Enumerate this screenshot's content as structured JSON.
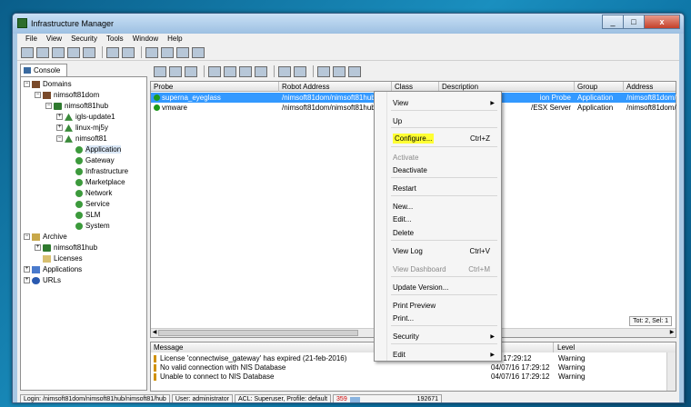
{
  "window": {
    "title": "Infrastructure Manager",
    "minimize": "_",
    "maximize": "□",
    "close": "x"
  },
  "menubar": [
    "File",
    "View",
    "Security",
    "Tools",
    "Window",
    "Help"
  ],
  "left_panel": {
    "tab_label": "Console",
    "tree": [
      {
        "label": "Domains",
        "level": 0,
        "expander": "−",
        "icon": "domain-icon"
      },
      {
        "label": "nimsoft81dom",
        "level": 1,
        "expander": "−",
        "icon": "domain-icon"
      },
      {
        "label": "nimsoft81hub",
        "level": 2,
        "expander": "−",
        "icon": "hub-icon"
      },
      {
        "label": "igls-update1",
        "level": 3,
        "expander": "+",
        "icon": "robot-icon"
      },
      {
        "label": "linux-mj5y",
        "level": 3,
        "expander": "+",
        "icon": "robot-icon"
      },
      {
        "label": "nimsoft81",
        "level": 3,
        "expander": "−",
        "icon": "robot-icon"
      },
      {
        "label": "Application",
        "level": 4,
        "expander": "",
        "icon": "group-icon",
        "selected": true
      },
      {
        "label": "Gateway",
        "level": 4,
        "expander": "",
        "icon": "group-icon"
      },
      {
        "label": "Infrastructure",
        "level": 4,
        "expander": "",
        "icon": "group-icon"
      },
      {
        "label": "Marketplace",
        "level": 4,
        "expander": "",
        "icon": "group-icon"
      },
      {
        "label": "Network",
        "level": 4,
        "expander": "",
        "icon": "group-icon"
      },
      {
        "label": "Service",
        "level": 4,
        "expander": "",
        "icon": "group-icon"
      },
      {
        "label": "SLM",
        "level": 4,
        "expander": "",
        "icon": "group-icon"
      },
      {
        "label": "System",
        "level": 4,
        "expander": "",
        "icon": "group-icon"
      },
      {
        "label": "Archive",
        "level": 0,
        "expander": "−",
        "icon": "archive-icon"
      },
      {
        "label": "nimsoft81hub",
        "level": 1,
        "expander": "+",
        "icon": "hub-icon"
      },
      {
        "label": "Licenses",
        "level": 1,
        "expander": "",
        "icon": "license-icon"
      },
      {
        "label": "Applications",
        "level": 0,
        "expander": "+",
        "icon": "applications-icon"
      },
      {
        "label": "URLs",
        "level": 0,
        "expander": "+",
        "icon": "url-icon"
      }
    ]
  },
  "probe_grid": {
    "columns": [
      "Probe",
      "Robot Address",
      "Class",
      "Description",
      "Group",
      "Address"
    ],
    "rows": [
      {
        "probe": "superna_eyeglass",
        "robot": "/nimsoft81dom/nimsoft81hub",
        "class": "",
        "description": "ion Probe",
        "group": "Application",
        "address": "/nimsoft81dom/",
        "selected": true
      },
      {
        "probe": "vmware",
        "robot": "/nimsoft81dom/nimsoft81hub",
        "class": "",
        "description": "/ESX Server",
        "group": "Application",
        "address": "/nimsoft81dom/",
        "selected": false
      }
    ],
    "total": "Tot: 2,  Sel: 1"
  },
  "messages": {
    "columns": [
      "Message",
      "",
      "Level"
    ],
    "rows": [
      {
        "message": "License 'connectwise_gateway' has expired (21-feb-2016)",
        "time": "",
        "level": "Warning"
      },
      {
        "message": "No valid connection with NIS Database",
        "time": "04/07/16 17:29:12",
        "level": "Warning"
      },
      {
        "message": "Unable to connect to NIS Database",
        "time": "04/07/16 17:29:12",
        "level": "Warning"
      }
    ],
    "first_row_time": "/16 17:29:12"
  },
  "statusbar": {
    "login": "Login: /nimsoft81dom/nimsoft81hub/nimsoft81/hub",
    "user": "User: administrator",
    "acl": "ACL: Superuser,  Profile: default",
    "mem_used": "359",
    "mem_total": "192671",
    "mem_fill": 0.19
  },
  "context_menu": {
    "items": [
      {
        "label": "View",
        "shortcut": "",
        "submenu": true,
        "disabled": false
      },
      {
        "label": "Up",
        "shortcut": "",
        "submenu": false,
        "disabled": false
      },
      {
        "label": "Configure...",
        "shortcut": "Ctrl+Z",
        "submenu": false,
        "disabled": false,
        "highlighted": true
      },
      {
        "label": "Activate",
        "shortcut": "",
        "submenu": false,
        "disabled": true
      },
      {
        "label": "Deactivate",
        "shortcut": "",
        "submenu": false,
        "disabled": false
      },
      {
        "label": "Restart",
        "shortcut": "",
        "submenu": false,
        "disabled": false
      },
      {
        "label": "New...",
        "shortcut": "",
        "submenu": false,
        "disabled": false
      },
      {
        "label": "Edit...",
        "shortcut": "",
        "submenu": false,
        "disabled": false
      },
      {
        "label": "Delete",
        "shortcut": "",
        "submenu": false,
        "disabled": false
      },
      {
        "label": "View Log",
        "shortcut": "Ctrl+V",
        "submenu": false,
        "disabled": false
      },
      {
        "label": "View Dashboard",
        "shortcut": "Ctrl+M",
        "submenu": false,
        "disabled": true
      },
      {
        "label": "Update Version...",
        "shortcut": "",
        "submenu": false,
        "disabled": false
      },
      {
        "label": "Print Preview",
        "shortcut": "",
        "submenu": false,
        "disabled": false
      },
      {
        "label": "Print...",
        "shortcut": "",
        "submenu": false,
        "disabled": false
      },
      {
        "label": "Security",
        "shortcut": "",
        "submenu": true,
        "disabled": false
      },
      {
        "label": "Edit",
        "shortcut": "",
        "submenu": true,
        "disabled": false
      }
    ]
  },
  "colors": {
    "selection": "#3399ff",
    "highlight": "#ffff33",
    "status_ok": "#1d9a1d"
  }
}
